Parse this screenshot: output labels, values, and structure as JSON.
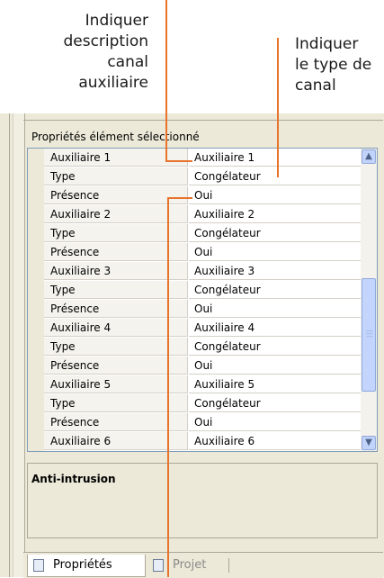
{
  "callouts": {
    "left_lines": [
      "Indiquer",
      "description",
      "canal",
      "auxiliaire"
    ],
    "right_lines": [
      "Indiquer",
      "le type de",
      "canal"
    ]
  },
  "section_title": "Propriétés élément sélectionné",
  "properties": [
    {
      "name": "Auxiliaire 1",
      "value": "Auxiliaire 1"
    },
    {
      "name": "Type",
      "value": "Congélateur"
    },
    {
      "name": "Présence",
      "value": "Oui"
    },
    {
      "name": "Auxiliaire 2",
      "value": "Auxiliaire 2"
    },
    {
      "name": "Type",
      "value": "Congélateur"
    },
    {
      "name": "Présence",
      "value": "Oui"
    },
    {
      "name": "Auxiliaire 3",
      "value": "Auxiliaire 3"
    },
    {
      "name": "Type",
      "value": "Congélateur"
    },
    {
      "name": "Présence",
      "value": "Oui"
    },
    {
      "name": "Auxiliaire 4",
      "value": "Auxiliaire 4"
    },
    {
      "name": "Type",
      "value": "Congélateur"
    },
    {
      "name": "Présence",
      "value": "Oui"
    },
    {
      "name": "Auxiliaire 5",
      "value": "Auxiliaire 5"
    },
    {
      "name": "Type",
      "value": "Congélateur"
    },
    {
      "name": "Présence",
      "value": "Oui"
    },
    {
      "name": "Auxiliaire 6",
      "value": "Auxiliaire 6"
    }
  ],
  "description_title": "Anti-intrusion",
  "tabs": {
    "properties_label": "Propriétés",
    "project_label": "Projet"
  },
  "colors": {
    "callout_line": "#e8732a",
    "panel_bg": "#ece9d8",
    "scroll_accent": "#c1d3fb"
  },
  "icons": {
    "scroll_up": "chevron-up-icon",
    "scroll_down": "chevron-down-icon",
    "properties_tab": "properties-icon",
    "project_tab": "project-icon"
  }
}
